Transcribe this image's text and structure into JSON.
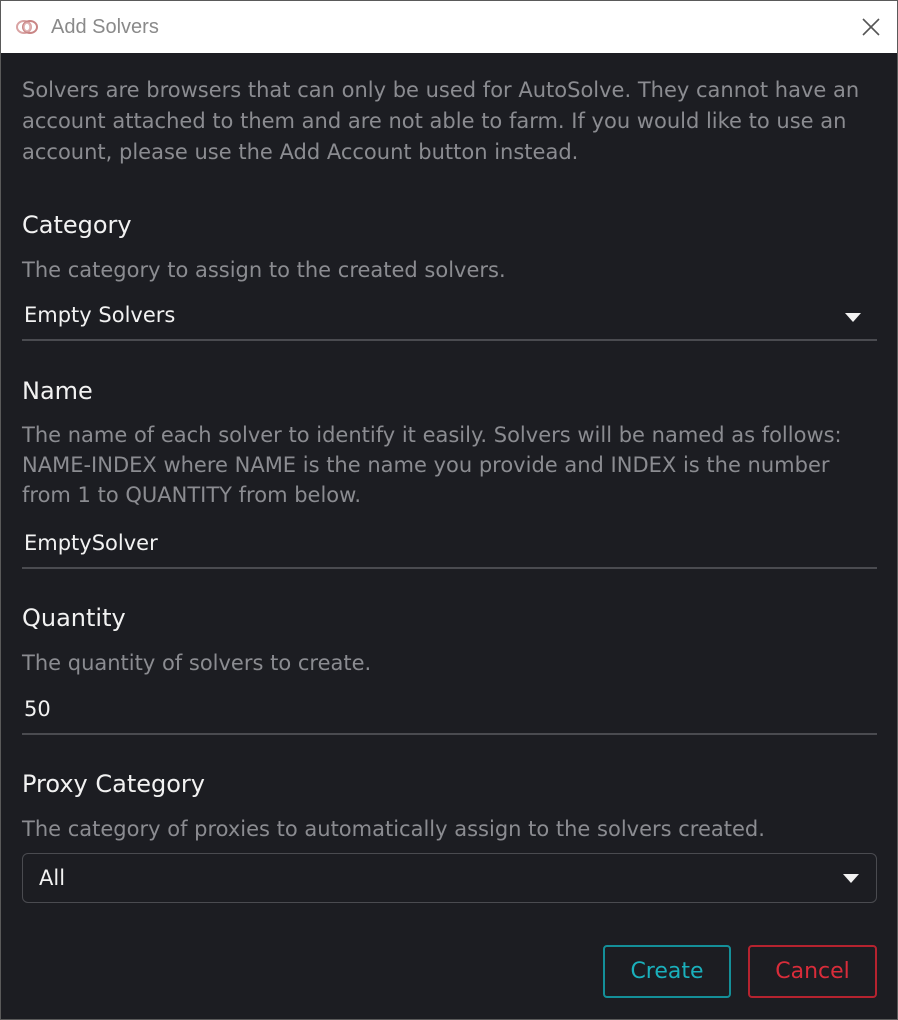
{
  "window": {
    "title": "Add Solvers",
    "close_icon": "close-icon",
    "app_icon": "autosolve-logo-icon"
  },
  "intro": "Solvers are browsers that can only be used for AutoSolve. They cannot have an account attached to them and are not able to farm. If you would like to use an account, please use the Add Account button instead.",
  "category": {
    "label": "Category",
    "description": "The category to assign to the created solvers.",
    "value": "Empty Solvers",
    "icon": "caret-down-icon"
  },
  "name": {
    "label": "Name",
    "description": "The name of each solver to identify it easily. Solvers will be named as follows: NAME-INDEX where NAME is the name you provide and INDEX is the number from 1 to QUANTITY from below.",
    "value": "EmptySolver"
  },
  "quantity": {
    "label": "Quantity",
    "description": "The quantity of solvers to create.",
    "value": "50"
  },
  "proxy_category": {
    "label": "Proxy Category",
    "description": "The category of proxies to automatically assign to the solvers created.",
    "value": "All",
    "icon": "caret-down-icon"
  },
  "actions": {
    "create_label": "Create",
    "cancel_label": "Cancel"
  },
  "colors": {
    "background": "#1c1d22",
    "create_accent": "#1ab0bc",
    "cancel_accent": "#d92c3a"
  }
}
